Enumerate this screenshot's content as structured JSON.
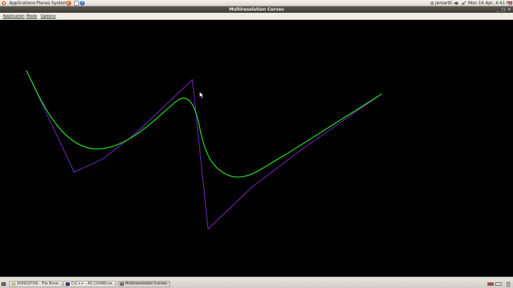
{
  "top_panel": {
    "menus": [
      "Applications",
      "Places",
      "System"
    ],
    "user": "jemartti",
    "datetime": "Mon 16 Apr,  4:41 PM"
  },
  "window": {
    "title": "Multiresolution Curves"
  },
  "menubar": {
    "items": [
      "Application",
      "Mode",
      "Options"
    ]
  },
  "taskbar": {
    "tasks": [
      {
        "label": "[KINGSTON - File Brow…"
      },
      {
        "label": "C/C++ - A5.CS488/vie…"
      },
      {
        "label": "Multiresolution Curves"
      }
    ]
  },
  "colors": {
    "curve": "#22e022",
    "control_polygon": "#8a2be2",
    "canvas_background": "#000000"
  },
  "icons": [
    "ubuntu-logo-icon",
    "firefox-icon",
    "mail-icon",
    "help-icon",
    "volume-icon",
    "network-icon",
    "power-icon",
    "show-desktop-icon",
    "trash-icon"
  ]
}
